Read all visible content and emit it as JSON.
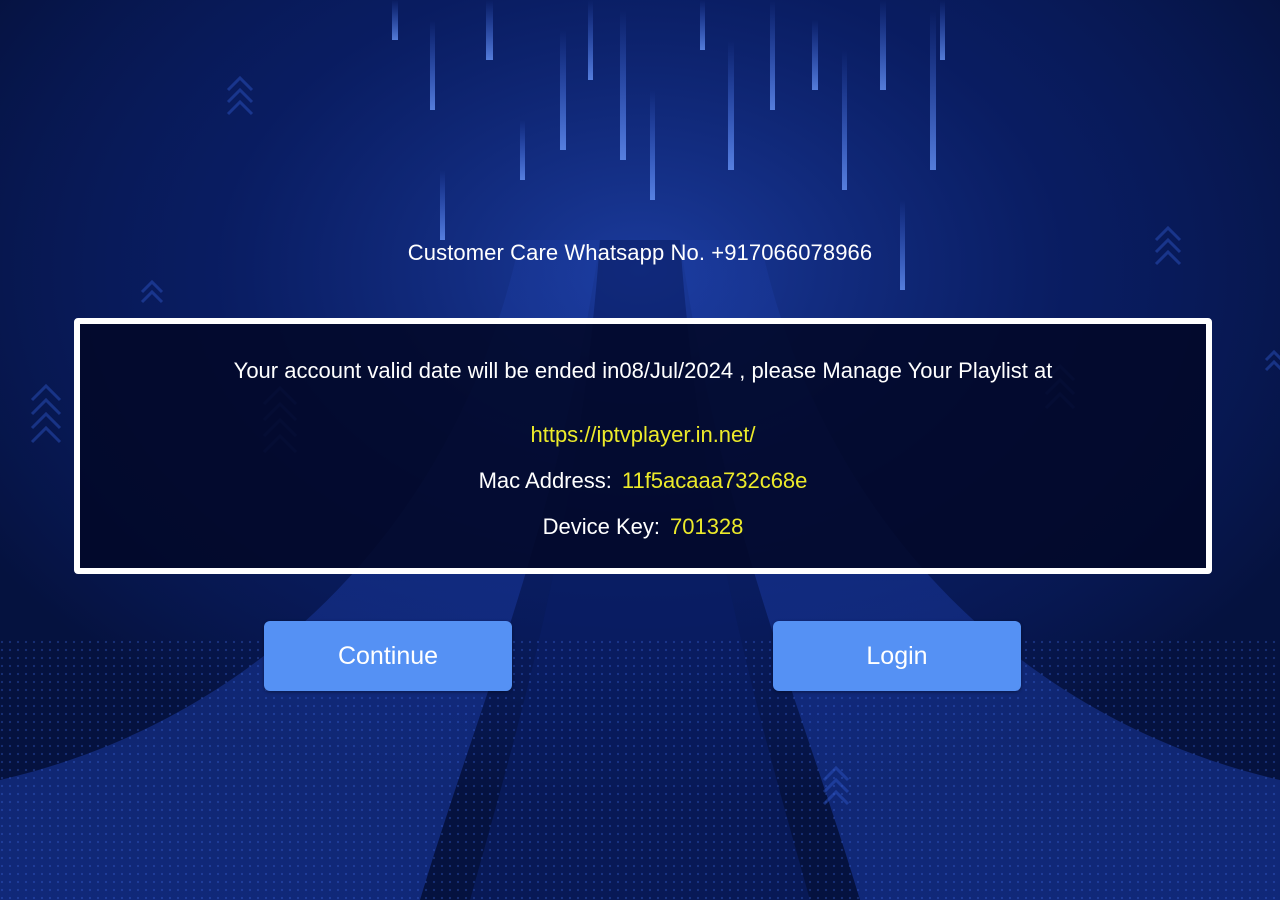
{
  "customer_care": {
    "text": "Customer Care Whatsapp No. +917066078966"
  },
  "account_notice": {
    "message": "Your account valid date will be ended in08/Jul/2024 , please Manage Your Playlist at",
    "url": "https://iptvplayer.in.net/",
    "mac_label": "Mac Address:",
    "mac_value": "11f5acaaa732c68e",
    "device_key_label": "Device Key:",
    "device_key_value": "701328"
  },
  "buttons": {
    "continue_label": "Continue",
    "login_label": "Login"
  },
  "colors": {
    "background": "#05123f",
    "accent_yellow": "#ecea2a",
    "button_blue": "#5591f4",
    "text_white": "#ffffff"
  }
}
